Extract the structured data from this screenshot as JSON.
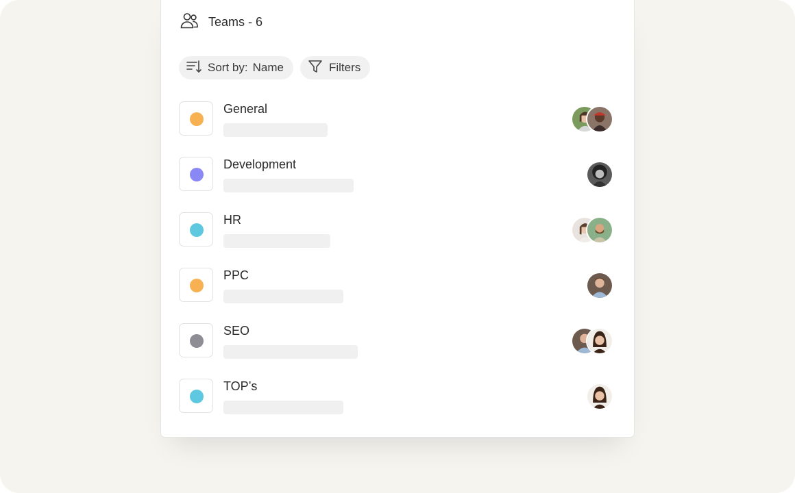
{
  "header": {
    "title": "Teams - 6",
    "icon": "users-icon"
  },
  "controls": {
    "sort_label": "Sort by:",
    "sort_value": "Name",
    "filters_label": "Filters"
  },
  "teams": [
    {
      "name": "General",
      "color": "#f8b152",
      "avatars": [
        "avatar-woman-green",
        "avatar-man-hat"
      ]
    },
    {
      "name": "Development",
      "color": "#8a88f5",
      "avatars": [
        "avatar-woman-bw"
      ]
    },
    {
      "name": "HR",
      "color": "#5ec8e0",
      "avatars": [
        "avatar-woman-light",
        "avatar-man-beard"
      ]
    },
    {
      "name": "PPC",
      "color": "#f8b152",
      "avatars": [
        "avatar-man-shirt"
      ]
    },
    {
      "name": "SEO",
      "color": "#8e8c94",
      "avatars": [
        "avatar-man-blue",
        "avatar-woman-smile"
      ]
    },
    {
      "name": "TOP’s",
      "color": "#5ec8e0",
      "avatars": [
        "avatar-woman-smile"
      ]
    }
  ]
}
